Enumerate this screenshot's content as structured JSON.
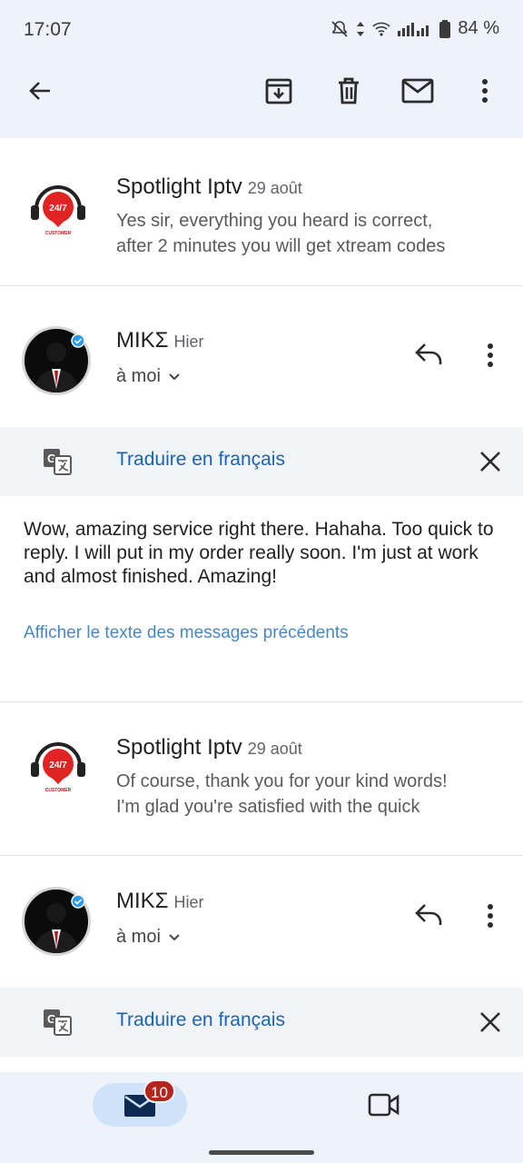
{
  "status_bar": {
    "time": "17:07",
    "battery": "84 %"
  },
  "toolbar": {
    "back_icon": "arrow-left-icon",
    "archive_icon": "archive-icon",
    "delete_icon": "trash-icon",
    "unread_icon": "mail-icon",
    "more_icon": "more-vertical-icon"
  },
  "messages": [
    {
      "sender": "Spotlight Iptv",
      "date": "29 août",
      "snippet_line1": "Yes sir, everything you heard is correct,",
      "snippet_line2": "after 2 minutes you will get xtream codes",
      "avatar_text": "24/7",
      "avatar_sub": "CUSTOMER"
    },
    {
      "sender": "MIKΣ",
      "date": "Hier",
      "recipient": "à moi",
      "translate_label": "Traduire en français",
      "body": "Wow, amazing service right there. Hahaha. Too quick to reply. I will put in my order really soon. I'm just at work and almost finished. Amazing!",
      "quoted_link": "Afficher le texte des messages précédents"
    },
    {
      "sender": "Spotlight Iptv",
      "date": "29 août",
      "snippet_line1": "Of course, thank you for your kind words!",
      "snippet_line2": "I'm glad you're satisfied with the quick",
      "avatar_text": "24/7",
      "avatar_sub": "CUSTOMER"
    },
    {
      "sender": "MIKΣ",
      "date": "Hier",
      "recipient": "à moi",
      "translate_label": "Traduire en français"
    }
  ],
  "bottom_nav": {
    "mail_badge": "10",
    "mail_icon": "mail-icon",
    "meet_icon": "video-icon"
  },
  "colors": {
    "accent_link": "#1a64b4",
    "badge": "#b3261e",
    "topbar_bg": "#eef2fa",
    "pill": "#cfe3f8"
  }
}
